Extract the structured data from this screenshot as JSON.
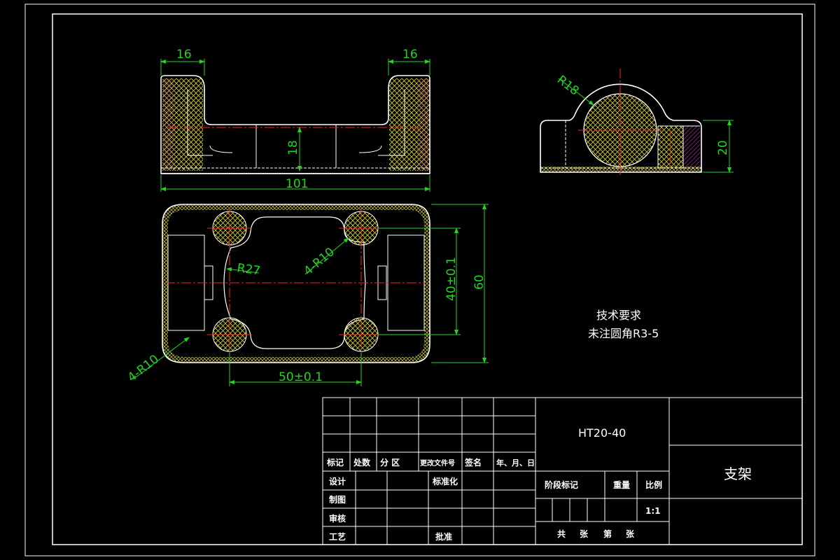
{
  "colors": {
    "background": "#000000",
    "outline": "#ffffff",
    "dimension": "#23d423",
    "centerline": "#ff2020",
    "hatch_yellow": "#d6d23a",
    "hatch_magenta": "#b3379d"
  },
  "front_view": {
    "dim_left_width": "16",
    "dim_right_width": "16",
    "dim_height": "18",
    "dim_total_length": "101"
  },
  "side_view": {
    "dim_radius": "R18",
    "dim_height": "20"
  },
  "top_view": {
    "dim_corner_holes_bottom": "4-R10",
    "dim_hole_radius": "4-R10",
    "dim_waist_radius": "R27",
    "dim_hole_spacing_vertical": "40±0.1",
    "dim_total_height": "60",
    "dim_hole_spacing_horizontal": "50±0.1"
  },
  "notes": {
    "title": "技术要求",
    "line1": "未注圆角R3-5"
  },
  "title_block": {
    "material": "HT20-40",
    "part_name": "支架",
    "rev_headers": [
      "标记",
      "处数",
      "分 区",
      "更改文件号",
      "签名",
      "年、月、日"
    ],
    "row_design": "设计",
    "row_standardize": "标准化",
    "row_draw": "制图",
    "row_review": "审核",
    "row_process": "工艺",
    "row_approve": "批准",
    "stage_mark": "阶段标记",
    "weight": "重量",
    "scale_label": "比例",
    "scale_value": "1:1",
    "sheet_total": "共",
    "sheet_unit": "张",
    "sheet_num": "第",
    "sheet_unit2": "张"
  }
}
